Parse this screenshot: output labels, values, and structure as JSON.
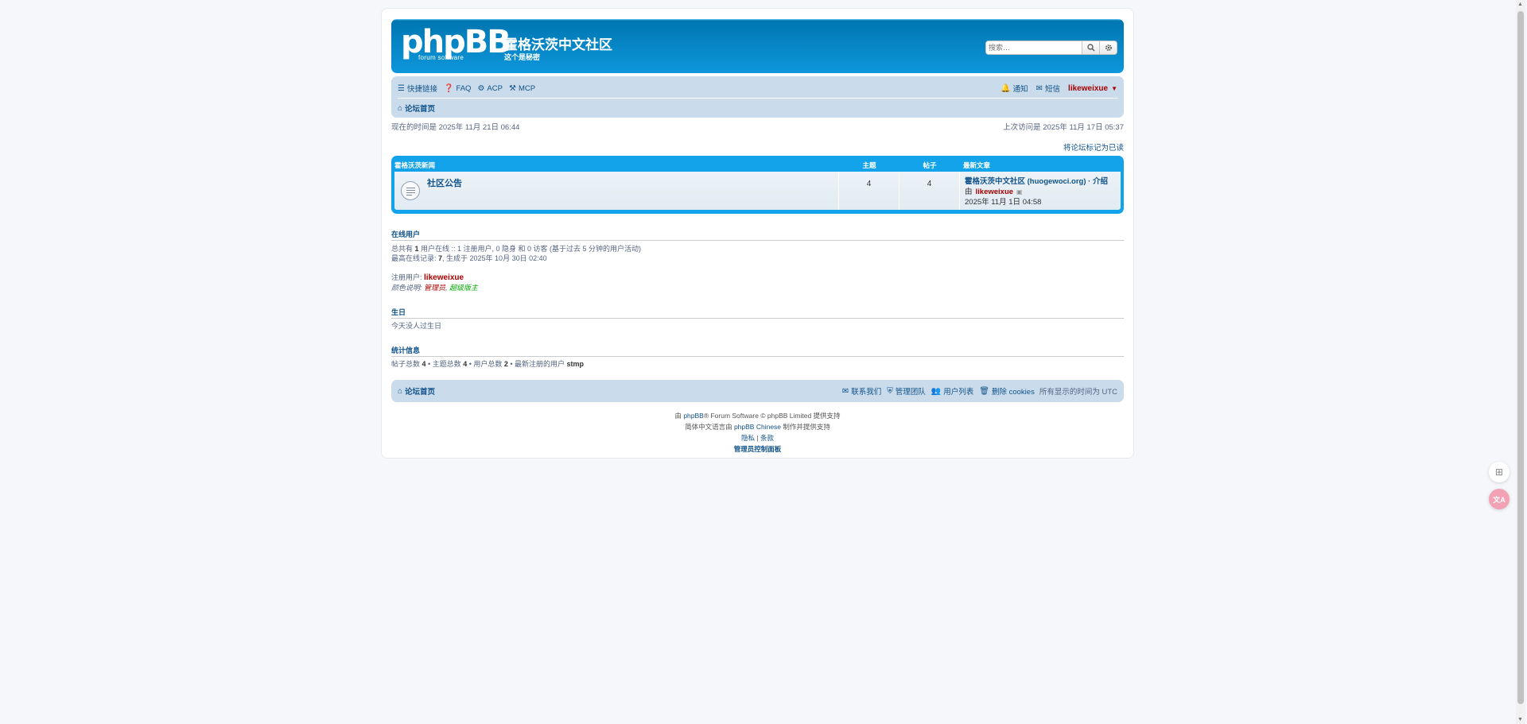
{
  "header": {
    "logo_main": "phpBB",
    "logo_sub": "forum software",
    "site_title": "霍格沃茨中文社区",
    "site_desc": "这个是秘密",
    "search_placeholder": "搜索…"
  },
  "navbar": {
    "quicklinks": "快捷链接",
    "faq": "FAQ",
    "acp": "ACP",
    "mcp": "MCP",
    "notifications": "通知",
    "messages": "短信",
    "username": "likeweixue",
    "breadcrumb_home": "论坛首页"
  },
  "times": {
    "current": "现在的时间是 2025年 11月 21日 06:44",
    "last_visit": "上次访问是 2025年 11月 17日 05:37",
    "mark_read": "将论坛标记为已读"
  },
  "forum_table": {
    "headers": {
      "category": "霍格沃茨新闻",
      "topics": "主题",
      "posts": "帖子",
      "last_post": "最新文章"
    },
    "rows": [
      {
        "title": "社区公告",
        "topics": "4",
        "posts": "4",
        "last_title": "霍格沃茨中文社区 (huogewoci.org) · 介绍",
        "last_by_prefix": "由",
        "last_by": "likeweixue",
        "last_time": "2025年 11月 1日 04:58"
      }
    ]
  },
  "online": {
    "title": "在线用户",
    "line1_a": "总共有 ",
    "line1_count": "1",
    "line1_b": " 用户在线 :: 1 注册用户, 0 隐身 和 0 访客 (基于过去 5 分钟的用户活动)",
    "line2_a": "最高在线记录: ",
    "line2_count": "7",
    "line2_b": ", 生成于 2025年 10月 30日 02:40",
    "registered_label": "注册用户: ",
    "registered_user": "likeweixue",
    "legend_label": "颜色说明: ",
    "legend_admin": "管理员",
    "legend_sep": ", ",
    "legend_gmod": "超级版主"
  },
  "birthdays": {
    "title": "生日",
    "text": "今天没人过生日"
  },
  "stats": {
    "title": "统计信息",
    "posts_label": "帖子总数 ",
    "posts": "4",
    "topics_label": " • 主题总数 ",
    "topics": "4",
    "users_label": " • 用户总数 ",
    "users": "2",
    "newest_label": " • 最新注册的用户 ",
    "newest": "stmp"
  },
  "footer": {
    "home": "论坛首页",
    "contact": "联系我们",
    "team": "管理团队",
    "members": "用户列表",
    "delete_cookies": "删除 cookies",
    "timezone": "所有显示的时间为 UTC"
  },
  "copyright": {
    "line1_a": "由 ",
    "line1_link": "phpBB",
    "line1_b": "® Forum Software © phpBB Limited 提供支持",
    "line2_a": "简体中文语言由 ",
    "line2_link": "phpBB Chinese",
    "line2_b": " 制作并提供支持",
    "privacy": "隐私",
    "sep": " | ",
    "terms": "条款",
    "acp_link": "管理员控制面板"
  },
  "colors": {
    "header_blue": "#12a3eb",
    "navbar_bg": "#cadceb",
    "link": "#105289",
    "admin_red": "#aa0000",
    "gmod_green": "#00aa00"
  }
}
